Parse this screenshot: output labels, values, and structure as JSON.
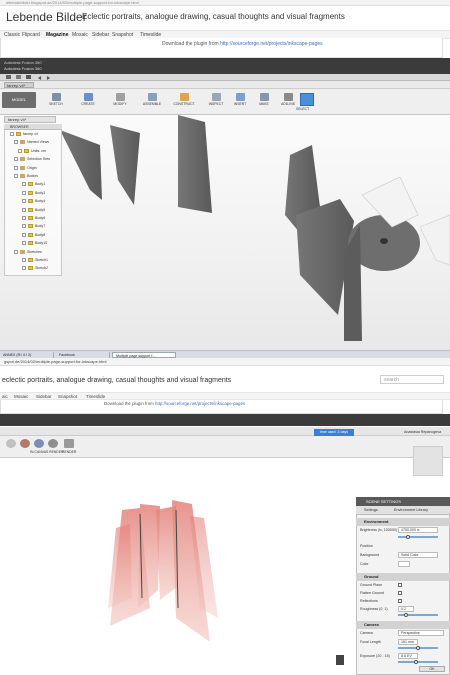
{
  "top_blog": {
    "url": "lebendebilder.blogspot.de/2014/02/multiple-page-support-for-inkscape.html",
    "title": "Lebende Bilder",
    "subtitle": "Eclectic portraits, analogue drawing, casual thoughts and visual fragments",
    "nav": [
      "Classic",
      "Flipcard",
      "Magazine",
      "Mosaic",
      "Sidebar",
      "Snapshot",
      "Timeslide"
    ],
    "nav_active": "Magazine",
    "plugin_text": "Download the plugin from",
    "plugin_link": "http://sourceforge.net/projects/inkscape-pages"
  },
  "fusion_top": {
    "app_title": "Autodesk Fusion 360",
    "window_line": "Autodesk Fusion 360",
    "doc_tab": "fanrep v4*",
    "mode": "MODEL",
    "ribbon": [
      {
        "name": "sketch-tool",
        "label": "SKETCH",
        "color": "#7e8fa8"
      },
      {
        "name": "create-tool",
        "label": "CREATE",
        "color": "#6c8fc9"
      },
      {
        "name": "modify-tool",
        "label": "MODIFY",
        "color": "#a0a0a0"
      },
      {
        "name": "assemble-tool",
        "label": "ASSEMBLE",
        "color": "#8aa0b8"
      },
      {
        "name": "construct-tool",
        "label": "CONSTRUCT",
        "color": "#e1a34f"
      },
      {
        "name": "inspect-tool",
        "label": "INSPECT",
        "color": "#9aa6b2"
      },
      {
        "name": "insert-tool",
        "label": "INSERT",
        "color": "#7d9fcc"
      },
      {
        "name": "make-tool",
        "label": "MAKE",
        "color": "#8796a8"
      },
      {
        "name": "add-ins-tool",
        "label": "ADD-INS",
        "color": "#8a8a8a"
      },
      {
        "name": "select-tool",
        "label": "SELECT",
        "color": "#4a8fd8"
      }
    ],
    "browser_title": "BROWSER",
    "tree": [
      {
        "label": "fanrep v4",
        "indent": 6,
        "kind": "doc"
      },
      {
        "label": "Named Views",
        "indent": 10,
        "kind": "folder"
      },
      {
        "label": "Units: cm",
        "indent": 14,
        "kind": "doc"
      },
      {
        "label": "Selection Sets",
        "indent": 10,
        "kind": "folder"
      },
      {
        "label": "Origin",
        "indent": 10,
        "kind": "folder"
      },
      {
        "label": "Bodies",
        "indent": 10,
        "kind": "folder"
      },
      {
        "label": "Body1",
        "indent": 18,
        "kind": "body"
      },
      {
        "label": "Body3",
        "indent": 18,
        "kind": "body"
      },
      {
        "label": "Body4",
        "indent": 18,
        "kind": "body"
      },
      {
        "label": "Body5",
        "indent": 18,
        "kind": "body"
      },
      {
        "label": "Body6",
        "indent": 18,
        "kind": "body"
      },
      {
        "label": "Body7",
        "indent": 18,
        "kind": "body"
      },
      {
        "label": "Body8",
        "indent": 18,
        "kind": "body"
      },
      {
        "label": "Body10",
        "indent": 18,
        "kind": "body"
      },
      {
        "label": "Sketches",
        "indent": 10,
        "kind": "folder"
      },
      {
        "label": "Sketch1",
        "indent": 18,
        "kind": "body"
      },
      {
        "label": "Sketch2",
        "indent": 18,
        "kind": "body"
      }
    ]
  },
  "taskbar": {
    "items": [
      "ANNEX (R:\\ 0:\\ 2)",
      "Facebook",
      "Multiple page support f..."
    ],
    "active_index": 2
  },
  "lower_blog": {
    "url": "gspot.de/2014/02/multiple-page-support-for-inkscape.html",
    "subtitle": "eclectic portraits, analogue drawing, casual thoughts and visual fragments",
    "search_placeholder": "search",
    "nav": [
      "aic",
      "Mosaic",
      "Sidebar",
      "Snapshot",
      "Timeslide"
    ],
    "plugin_text": "Download the plugin from",
    "plugin_link": "http://sourceforge.net/projects/inkscape-pages"
  },
  "fusion_bottom": {
    "time_left": "time used: 3 days",
    "user": "Anastasia Repanogeva",
    "ribbon": [
      "IN-CANVAS RENDER",
      "RENDER"
    ],
    "scene": {
      "title": "SCENE SETTINGS",
      "tabs": [
        "Settings",
        "Environment Library"
      ],
      "environment_header": "Environment",
      "brightness_label": "Brightness (lx, 100000)",
      "brightness_value": "4750.000 lx",
      "position_label": "Position",
      "background_label": "Background",
      "background_value": "Solid Color",
      "color_label": "Color",
      "ground_header": "Ground",
      "ground_plane_label": "Ground Plane",
      "flatten_label": "Flatten Ground",
      "reflections_label": "Reflections",
      "roughness_label": "Roughness (0, 1)",
      "roughness_value": "0.2",
      "camera_header": "Camera",
      "camera_label": "Camera",
      "camera_value": "Perspective",
      "focal_label": "Focal Length",
      "focal_value": "161 mm",
      "exposure_label": "Exposure (20 - 15)",
      "exposure_value": "8.6 EV",
      "ok": "OK"
    }
  }
}
